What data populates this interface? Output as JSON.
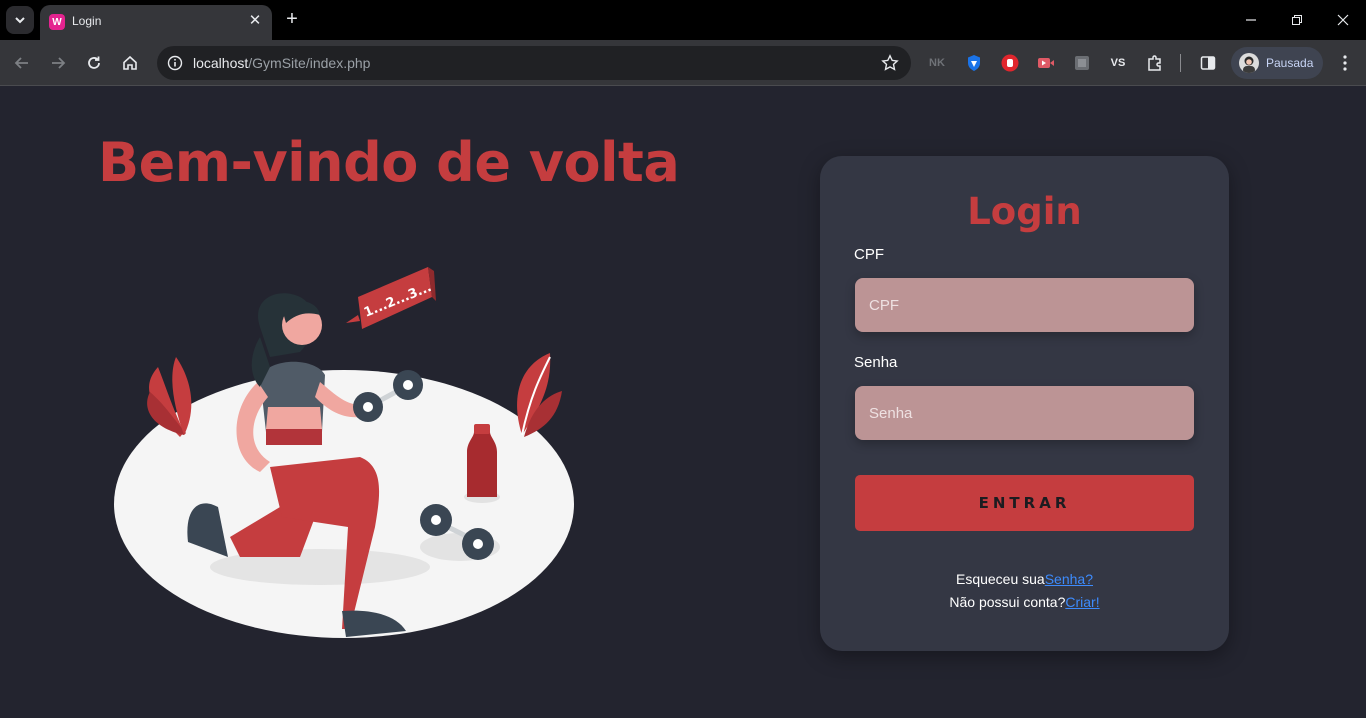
{
  "browser": {
    "tab": {
      "title": "Login",
      "favicon_icon": "w-favicon-icon"
    },
    "url": {
      "host": "localhost",
      "path": "/GymSite/index.php"
    },
    "profile_name": "Pausada",
    "extensions": [
      "nk-extension-icon",
      "shield-extension-icon",
      "stop-hand-extension-icon",
      "video-extension-icon",
      "square-extension-icon",
      "vs-extension-icon",
      "puzzle-icon"
    ],
    "accent": "#e4238f"
  },
  "page": {
    "headline": "Bem-vindo de volta",
    "illustration": {
      "speech_bubble_text": "1...2...3..."
    },
    "login": {
      "title": "Login",
      "cpf_label": "CPF",
      "cpf_placeholder": "CPF",
      "password_label": "Senha",
      "password_placeholder": "Senha",
      "submit_label": "ENTRAR",
      "forgot_text": "Esqueceu sua",
      "forgot_link": "Senha?",
      "no_account_text": "Não possui conta?",
      "create_link": "Criar!"
    }
  },
  "colors": {
    "background": "#23242f",
    "card": "#343744",
    "brand_red": "#c53d3f",
    "input_bg": "#bc9495",
    "link": "#3d8bfd"
  }
}
